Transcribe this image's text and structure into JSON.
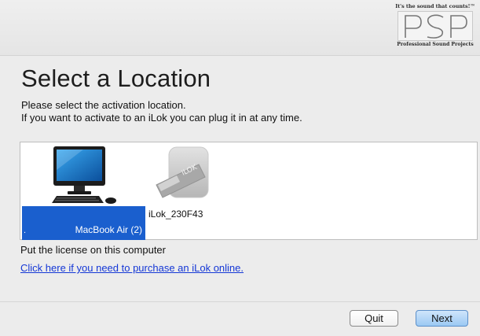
{
  "branding": {
    "tagline": "It's the sound that counts!™",
    "logo_text": "PSP",
    "company": "Professional Sound Projects"
  },
  "heading": "Select a Location",
  "description": {
    "line1": "Please select the activation location.",
    "line2": "If you want to activate to an iLok you can plug it in at any time."
  },
  "locations": [
    {
      "label": "MacBook Air (2)",
      "prefix": ".",
      "icon": "desktop-computer-icon",
      "selected": true
    },
    {
      "label": "iLok_230F43",
      "icon": "ilok-usb-icon",
      "selected": false
    }
  ],
  "status_text": "Put the license on this computer",
  "purchase_link": "Click here if you need to purchase an iLok online.",
  "buttons": {
    "quit": "Quit",
    "next": "Next"
  },
  "colors": {
    "selection": "#1a5fce",
    "link": "#1437d6",
    "default_button": "#9bc9f3"
  }
}
